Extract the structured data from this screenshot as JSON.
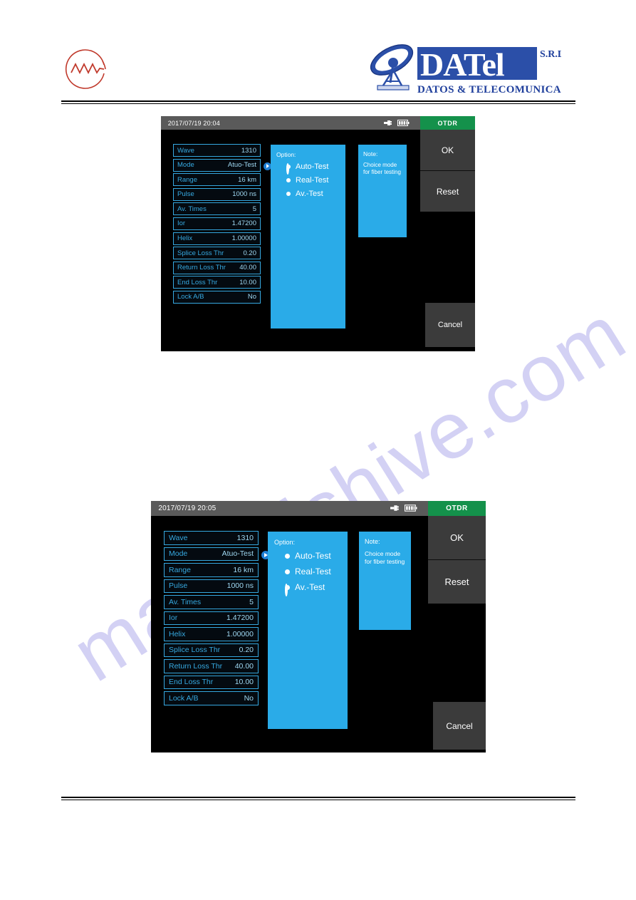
{
  "document": {
    "brand": {
      "mark_icon": "waveform-circle-icon",
      "company": "DATel",
      "suffix": "S.R.L.",
      "tagline": "DATOS & TELECOMUNICACIONES",
      "satellite_icon": "satellite-dish-icon",
      "brand_color": "#1f3f9c"
    },
    "watermark": "manualshive.com"
  },
  "screenshots": [
    {
      "id": "screenshot-1",
      "statusbar": {
        "datetime": "2017/07/19 20:04",
        "plug_icon": "power-plug-icon",
        "battery_icon": "battery-icon",
        "mode_label": "OTDR",
        "mode_color": "#14914b"
      },
      "params": [
        {
          "label": "Wave",
          "value": "1310",
          "arrow": false
        },
        {
          "label": "Mode",
          "value": "Atuo-Test",
          "arrow": true
        },
        {
          "label": "Range",
          "value": "16 km",
          "arrow": false
        },
        {
          "label": "Pulse",
          "value": "1000 ns",
          "arrow": false
        },
        {
          "label": "Av. Times",
          "value": "5",
          "arrow": false
        },
        {
          "label": "Ior",
          "value": "1.47200",
          "arrow": false
        },
        {
          "label": "Helix",
          "value": "1.00000",
          "arrow": false
        },
        {
          "label": "Splice Loss Thr",
          "value": "0.20",
          "arrow": false
        },
        {
          "label": "Return Loss Thr",
          "value": "40.00",
          "arrow": false
        },
        {
          "label": "End Loss Thr",
          "value": "10.00",
          "arrow": false
        },
        {
          "label": "Lock A/B",
          "value": "No",
          "arrow": false
        }
      ],
      "option_panel": {
        "title": "Option:",
        "items": [
          {
            "label": "Auto-Test",
            "selected": true
          },
          {
            "label": "Real-Test",
            "selected": false
          },
          {
            "label": "Av.-Test",
            "selected": false
          }
        ]
      },
      "note_panel": {
        "title": "Note:",
        "text": "Choice mode for fiber testing"
      },
      "buttons": {
        "ok": "OK",
        "reset": "Reset",
        "cancel": "Cancel"
      }
    },
    {
      "id": "screenshot-2",
      "statusbar": {
        "datetime": "2017/07/19 20:05",
        "plug_icon": "power-plug-icon",
        "battery_icon": "battery-icon",
        "mode_label": "OTDR",
        "mode_color": "#14914b"
      },
      "params": [
        {
          "label": "Wave",
          "value": "1310",
          "arrow": false
        },
        {
          "label": "Mode",
          "value": "Atuo-Test",
          "arrow": true
        },
        {
          "label": "Range",
          "value": "16 km",
          "arrow": false
        },
        {
          "label": "Pulse",
          "value": "1000 ns",
          "arrow": false
        },
        {
          "label": "Av. Times",
          "value": "5",
          "arrow": false
        },
        {
          "label": "Ior",
          "value": "1.47200",
          "arrow": false
        },
        {
          "label": "Helix",
          "value": "1.00000",
          "arrow": false
        },
        {
          "label": "Splice Loss Thr",
          "value": "0.20",
          "arrow": false
        },
        {
          "label": "Return Loss Thr",
          "value": "40.00",
          "arrow": false
        },
        {
          "label": "End Loss Thr",
          "value": "10.00",
          "arrow": false
        },
        {
          "label": "Lock A/B",
          "value": "No",
          "arrow": false
        }
      ],
      "option_panel": {
        "title": "Option:",
        "items": [
          {
            "label": "Auto-Test",
            "selected": false
          },
          {
            "label": "Real-Test",
            "selected": false
          },
          {
            "label": "Av.-Test",
            "selected": true
          }
        ]
      },
      "note_panel": {
        "title": "Note:",
        "text": "Choice mode for fiber testing"
      },
      "buttons": {
        "ok": "OK",
        "reset": "Reset",
        "cancel": "Cancel"
      }
    }
  ]
}
